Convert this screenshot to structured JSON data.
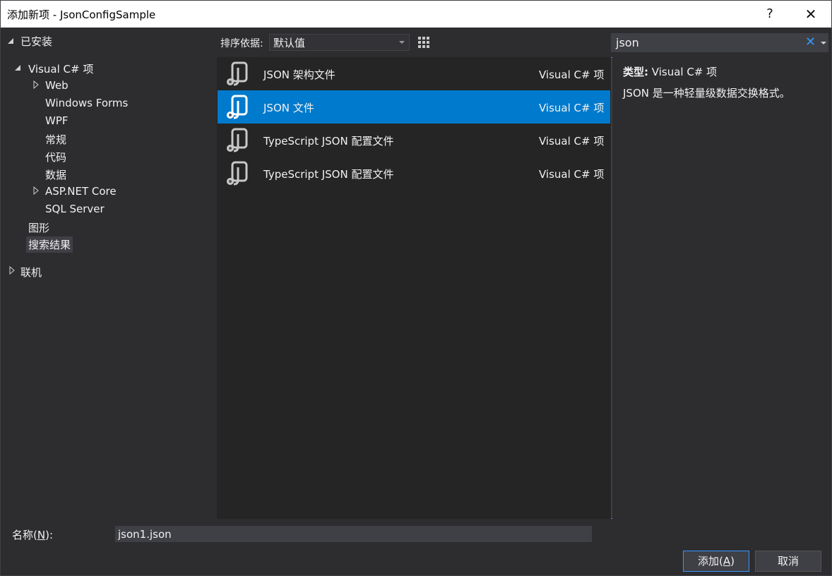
{
  "window": {
    "title": "添加新项 - JsonConfigSample",
    "help_glyph": "?",
    "close_glyph": "✕"
  },
  "tree": {
    "installed": "已安装",
    "visual_csharp": "Visual C# 项",
    "web": "Web",
    "windows_forms": "Windows Forms",
    "wpf": "WPF",
    "general": "常规",
    "code": "代码",
    "data": "数据",
    "aspnet_core": "ASP.NET Core",
    "sql_server": "SQL Server",
    "graphics": "图形",
    "search_results": "搜索结果",
    "online": "联机"
  },
  "toolbar": {
    "sort_label": "排序依据:",
    "sort_value": "默认值"
  },
  "search": {
    "value": "json",
    "clear_glyph": "✕"
  },
  "items": [
    {
      "name": "JSON 架构文件",
      "category": "Visual C# 项",
      "selected": false
    },
    {
      "name": "JSON 文件",
      "category": "Visual C# 项",
      "selected": true
    },
    {
      "name": "TypeScript JSON 配置文件",
      "category": "Visual C# 项",
      "selected": false
    },
    {
      "name": "TypeScript JSON 配置文件",
      "category": "Visual C# 项",
      "selected": false
    }
  ],
  "details": {
    "type_label": "类型:",
    "type_value": "Visual C# 项",
    "description": "JSON 是一种轻量级数据交换格式。"
  },
  "footer": {
    "name_label_prefix": "名称(",
    "name_label_key": "N",
    "name_label_suffix": "):",
    "name_value": "json1.json",
    "add_label_prefix": "添加(",
    "add_label_key": "A",
    "add_label_suffix": ")",
    "cancel_label": "取消"
  },
  "colors": {
    "background": "#2d2d30",
    "list_background": "#252526",
    "selection": "#007acc",
    "accent": "#3399ff"
  }
}
